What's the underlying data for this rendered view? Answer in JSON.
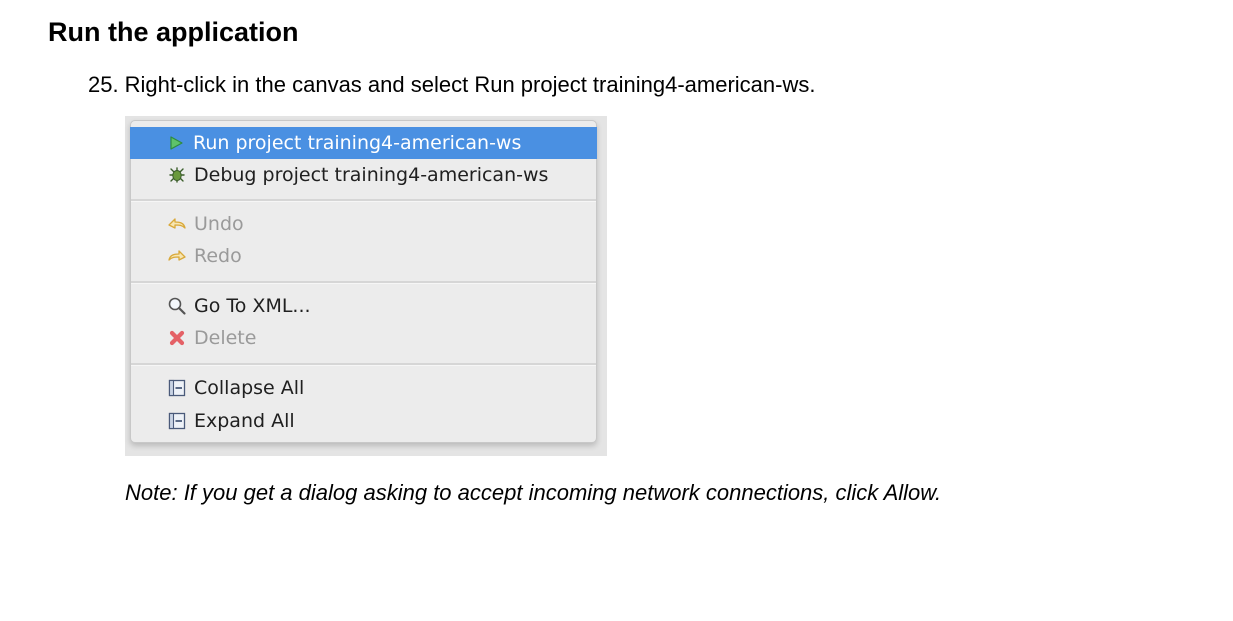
{
  "doc": {
    "heading": "Run the application",
    "step": {
      "number": "25.",
      "text": "Right-click in the canvas and select Run project training4-american-ws."
    },
    "note": "Note: If you get a dialog asking to accept incoming network connections, click Allow."
  },
  "menu": {
    "items": [
      {
        "label": "Run project training4-american-ws",
        "icon": "run-play-icon",
        "state": "selected"
      },
      {
        "label": "Debug project training4-american-ws",
        "icon": "debug-bug-icon",
        "state": "enabled"
      },
      {
        "label": "Undo",
        "icon": "undo-icon",
        "state": "disabled"
      },
      {
        "label": "Redo",
        "icon": "redo-icon",
        "state": "disabled"
      },
      {
        "label": "Go To XML...",
        "icon": "search-icon",
        "state": "enabled"
      },
      {
        "label": "Delete",
        "icon": "delete-x-icon",
        "state": "disabled"
      },
      {
        "label": "Collapse All",
        "icon": "collapse-all-icon",
        "state": "enabled"
      },
      {
        "label": "Expand All",
        "icon": "expand-all-icon",
        "state": "enabled"
      }
    ],
    "colors": {
      "selected_bg": "#4a90e2",
      "menu_bg": "#ececec",
      "disabled_text": "#9a9a9a",
      "run_icon": "#3fa34d",
      "delete_icon": "#e0555a"
    }
  }
}
